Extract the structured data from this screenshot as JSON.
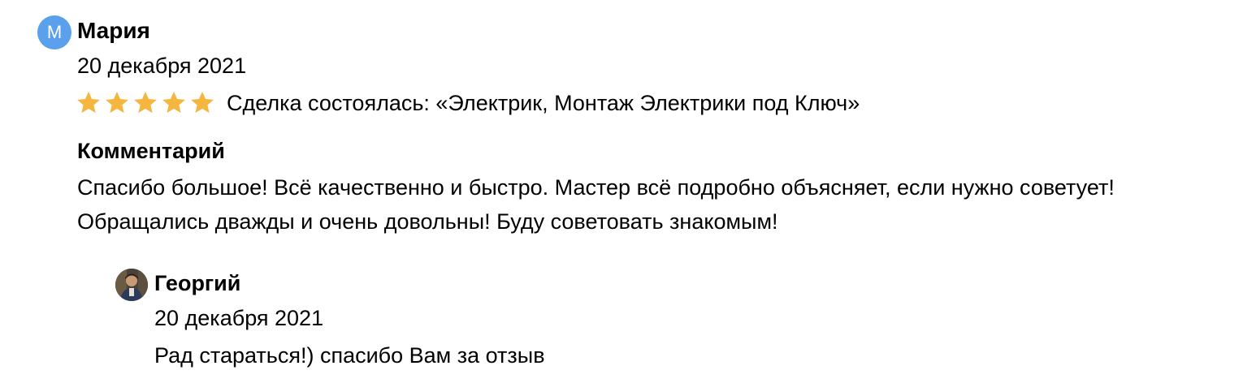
{
  "review": {
    "author_initial": "М",
    "author_name": "Мария",
    "date": "20 декабря 2021",
    "rating": 5,
    "rating_max": 5,
    "star_color": "#f4b63e",
    "deal_text": "Сделка состоялась: «Электрик, Монтаж Электрики под Ключ»",
    "comment_heading": "Комментарий",
    "comment_text": "Спасибо большое! Всё качественно и быстро. Мастер всё подробно объясняет, если нужно советует! Обращались дважды и очень довольны! Буду советовать знакомым!",
    "avatar_color": "#5aa0ec"
  },
  "reply": {
    "author_name": "Георгий",
    "date": "20 декабря 2021",
    "text": "Рад стараться!) спасибо Вам за отзыв"
  }
}
